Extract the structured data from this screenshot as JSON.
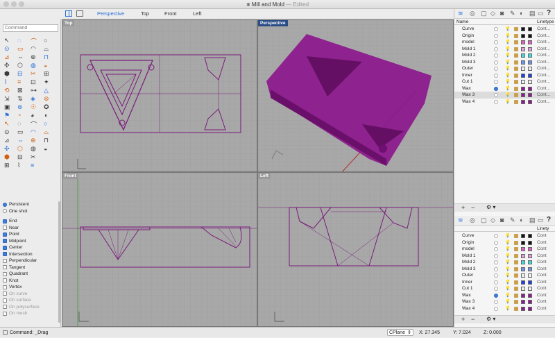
{
  "window": {
    "title": "Mill and Mold",
    "edited": "— Edited"
  },
  "viewport_tabs": [
    "Perspective",
    "Top",
    "Front",
    "Left"
  ],
  "command": {
    "placeholder": "Command"
  },
  "osnap": {
    "persistent_label": "Persistent",
    "oneshot_label": "One shot",
    "items": [
      {
        "label": "End",
        "checked": true,
        "enabled": true
      },
      {
        "label": "Near",
        "checked": false,
        "enabled": true
      },
      {
        "label": "Point",
        "checked": true,
        "enabled": true
      },
      {
        "label": "Midpoint",
        "checked": true,
        "enabled": true
      },
      {
        "label": "Center",
        "checked": true,
        "enabled": true
      },
      {
        "label": "Intersection",
        "checked": true,
        "enabled": true
      },
      {
        "label": "Perpendicular",
        "checked": false,
        "enabled": true
      },
      {
        "label": "Tangent",
        "checked": false,
        "enabled": true
      },
      {
        "label": "Quadrant",
        "checked": false,
        "enabled": true
      },
      {
        "label": "Knot",
        "checked": false,
        "enabled": true
      },
      {
        "label": "Vertex",
        "checked": false,
        "enabled": true
      },
      {
        "label": "On curve",
        "checked": false,
        "enabled": false
      },
      {
        "label": "On surface",
        "checked": false,
        "enabled": false
      },
      {
        "label": "On polysurface",
        "checked": false,
        "enabled": false
      },
      {
        "label": "On mesh",
        "checked": false,
        "enabled": false
      }
    ]
  },
  "viewports": {
    "top": "Top",
    "perspective": "Perspective",
    "front": "Front",
    "left": "Left"
  },
  "layers_top": {
    "col_name": "Name",
    "col_linetype": "Linetype",
    "rows": [
      {
        "name": "Curve",
        "color": "#111111",
        "linetype": "Cont...",
        "current": false
      },
      {
        "name": "Origin",
        "color": "#111111",
        "linetype": "Cont...",
        "current": false
      },
      {
        "name": "model",
        "color": "#e060c0",
        "linetype": "Cont...",
        "current": false
      },
      {
        "name": "Mold 1",
        "color": "#e0a0d8",
        "linetype": "Cont...",
        "current": false
      },
      {
        "name": "Mold 2",
        "color": "#40d8d8",
        "linetype": "Cont...",
        "current": false
      },
      {
        "name": "Mold 3",
        "color": "#7090e0",
        "linetype": "Cont...",
        "current": false
      },
      {
        "name": "Outer",
        "color": "#f0f0f0",
        "linetype": "Cont...",
        "current": false
      },
      {
        "name": "Inner",
        "color": "#2040e0",
        "linetype": "Cont...",
        "current": false
      },
      {
        "name": "Cut 1",
        "color": "#f0f0f0",
        "linetype": "Cont...",
        "current": false
      },
      {
        "name": "Wax",
        "color": "#901890",
        "linetype": "Cont...",
        "current": true
      },
      {
        "name": "Wax 3",
        "color": "#901890",
        "linetype": "Cont...",
        "current": false,
        "selected": true
      },
      {
        "name": "Wax 4",
        "color": "#901890",
        "linetype": "Cont...",
        "current": false
      }
    ]
  },
  "layers_bottom": {
    "col_linetype": "Linety",
    "rows": [
      {
        "name": "Curve",
        "color": "#111111",
        "linetype": "Cont"
      },
      {
        "name": "Origin",
        "color": "#111111",
        "linetype": "Cont"
      },
      {
        "name": "model",
        "color": "#e060c0",
        "linetype": "Cont"
      },
      {
        "name": "Mold 1",
        "color": "#e0a0d8",
        "linetype": "Cont"
      },
      {
        "name": "Mold 2",
        "color": "#40d8d8",
        "linetype": "Cont"
      },
      {
        "name": "Mold 3",
        "color": "#7090e0",
        "linetype": "Cont"
      },
      {
        "name": "Outer",
        "color": "#f0f0f0",
        "linetype": "Cont"
      },
      {
        "name": "Inner",
        "color": "#2040e0",
        "linetype": "Cont"
      },
      {
        "name": "Cut 1",
        "color": "#f0f0f0",
        "linetype": "Cont"
      },
      {
        "name": "Wax",
        "color": "#901890",
        "linetype": "Cont",
        "current": true
      },
      {
        "name": "Wax 3",
        "color": "#901890",
        "linetype": "Cont"
      },
      {
        "name": "Wax 4",
        "color": "#901890",
        "linetype": "Cont"
      }
    ]
  },
  "status": {
    "command": "Command: _Drag",
    "cplane": "CPlane",
    "x": "X: 27.345",
    "y": "Y: 7.024",
    "z": "Z: 0.000"
  },
  "colors": {
    "accent": "#2a6fd6",
    "wax": "#8c1a8c",
    "viewport_bg": "#a9a9a9"
  }
}
